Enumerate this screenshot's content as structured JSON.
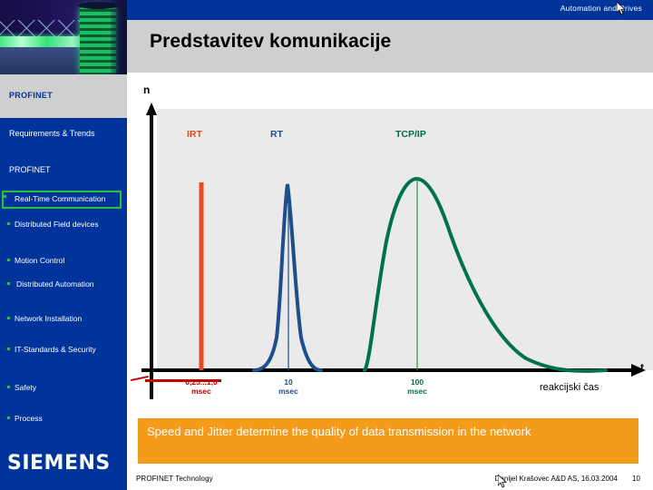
{
  "header": {
    "brand_line": "Automation and Drives",
    "title": "Predstavitev komunikacije",
    "bar_color": "#00349a",
    "band_color": "#cfcfcf"
  },
  "sidebar": {
    "top_label": "PROFINET",
    "section_items": [
      {
        "label": "Requirements & Trends",
        "bulleted": false,
        "highlighted": false
      },
      {
        "label": "PROFINET",
        "bulleted": false,
        "highlighted": false
      },
      {
        "label": "Real-Time Communication",
        "bulleted": true,
        "highlighted": true
      },
      {
        "label": "Distributed Field devices",
        "bulleted": true,
        "highlighted": false
      },
      {
        "label": "Motion Control",
        "bulleted": true,
        "highlighted": false
      },
      {
        "label": "Distributed Automation",
        "bulleted": true,
        "highlighted": false
      },
      {
        "label": "Network Installation",
        "bulleted": true,
        "highlighted": false
      },
      {
        "label": "IT-Standards & Security",
        "bulleted": true,
        "highlighted": false
      },
      {
        "label": "Safety",
        "bulleted": true,
        "highlighted": false
      },
      {
        "label": "Process",
        "bulleted": true,
        "highlighted": false
      }
    ],
    "logo": "SIEMENS",
    "nav_color": "#00349a",
    "highlight_color": "#22c43b",
    "bullet_color": "#2fbf57"
  },
  "chart_data": {
    "type": "line",
    "title": "",
    "xlabel": "t",
    "ylabel": "n",
    "x_axis_caption": "reakcijski čas",
    "grid": false,
    "legend_position": "inline-above-curves",
    "plot_bg": "#eaeaea",
    "series": [
      {
        "name": "IRT",
        "color": "#e8491f",
        "shape": "impulse",
        "peak_x_label": "0,25...1,0",
        "peak_x_unit": "msec",
        "peak_height": 0.72,
        "strikethrough": true
      },
      {
        "name": "RT",
        "color": "#1e4e8c",
        "shape": "narrow-peak",
        "peak_x_label": "10",
        "peak_x_unit": "msec",
        "peak_height": 0.76
      },
      {
        "name": "TCP/IP",
        "color": "#00714f",
        "shape": "broad-skewed-peak",
        "peak_x_label": "100",
        "peak_x_unit": "msec",
        "peak_height": 0.79
      }
    ],
    "x_tick_labels": [
      "0,25...1,0 msec",
      "10 msec",
      "100 msec"
    ],
    "y_tick_labels": []
  },
  "banner": {
    "text": "Speed and Jitter determine the quality of data transmission in the network",
    "color": "#f59b1c"
  },
  "footer": {
    "left": "PROFINET Technology",
    "author": "Danijel Krašovec A&D AS,",
    "date": "16.03.2004",
    "page": "10"
  }
}
